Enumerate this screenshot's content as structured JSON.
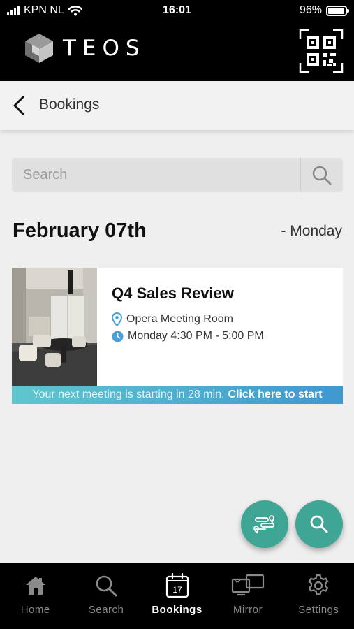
{
  "status_bar": {
    "carrier": "KPN NL",
    "time": "16:01",
    "battery_percent": "96%",
    "battery_level": 0.96
  },
  "app_header": {
    "brand": "TEOS",
    "qr_icon": "qr-code-icon"
  },
  "page": {
    "title": "Bookings",
    "back_icon": "chevron-left-icon"
  },
  "search": {
    "placeholder": "Search",
    "value": "",
    "icon": "search-icon"
  },
  "date_group": {
    "date": "February 07th",
    "weekday": "- Monday"
  },
  "booking": {
    "title": "Q4 Sales Review",
    "location": "Opera Meeting Room",
    "time": "Monday 4:30 PM - 5:00 PM",
    "location_icon": "map-pin-icon",
    "time_icon": "clock-icon",
    "banner_message": "Your next meeting is starting in 28 min.",
    "banner_cta": "Click here to start"
  },
  "fabs": [
    {
      "icon": "route-icon"
    },
    {
      "icon": "search-icon"
    }
  ],
  "colors": {
    "accent_teal": "#3fa696",
    "banner_start": "#5fc6cd",
    "banner_end": "#3f97cf",
    "pin_blue": "#4a9fd8"
  },
  "nav": {
    "items": [
      {
        "label": "Home",
        "icon": "home-icon"
      },
      {
        "label": "Search",
        "icon": "search-icon"
      },
      {
        "label": "Bookings",
        "icon": "calendar-icon",
        "calendar_day": "17",
        "active": true
      },
      {
        "label": "Mirror",
        "icon": "mirror-screens-icon"
      },
      {
        "label": "Settings",
        "icon": "gear-icon"
      }
    ]
  }
}
